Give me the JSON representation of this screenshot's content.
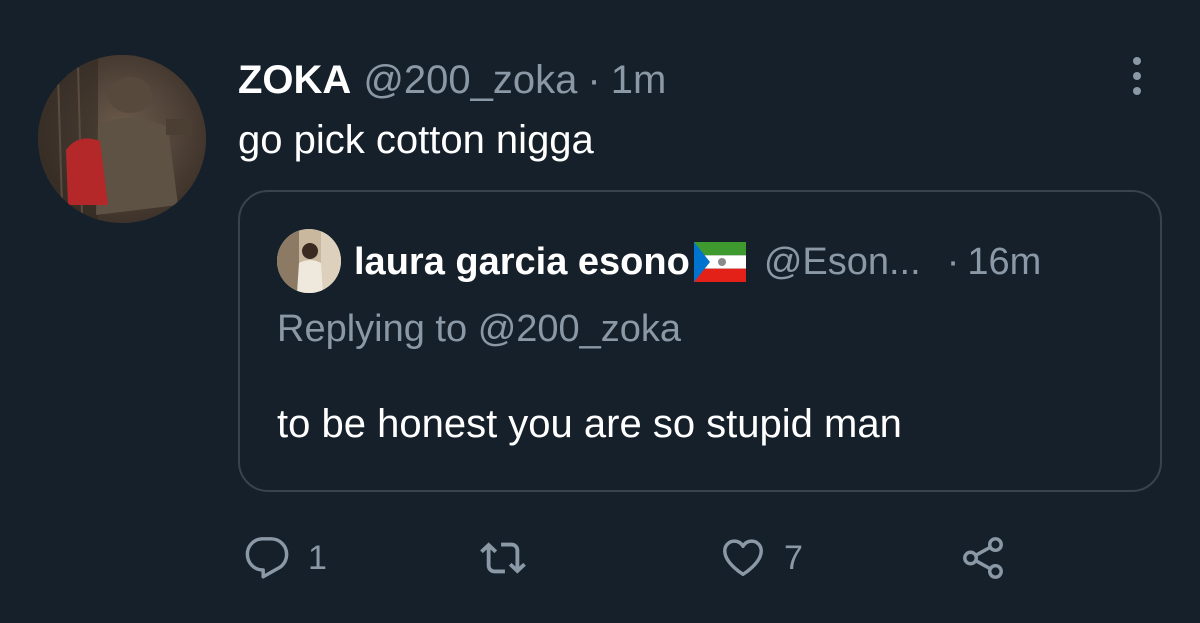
{
  "tweet": {
    "display_name": "ZOKA",
    "handle": "@200_zoka",
    "separator": "·",
    "time": "1m",
    "text": "go pick cotton nigga"
  },
  "quoted": {
    "display_name": "laura garcia esono",
    "handle": "@Eson...",
    "separator": "·",
    "time": "16m",
    "replying_prefix": "Replying to",
    "replying_handle": "@200_zoka",
    "text": "to be honest you are so stupid man"
  },
  "actions": {
    "reply_count": "1",
    "like_count": "7"
  },
  "icons": {
    "more": "more-vertical-icon",
    "reply": "reply-icon",
    "retweet": "retweet-icon",
    "like": "heart-icon",
    "share": "share-icon",
    "flag": "equatorial-guinea-flag-icon"
  },
  "colors": {
    "background": "#15202b",
    "text_primary": "#ffffff",
    "text_secondary": "#8b98a5",
    "border": "#38444d"
  }
}
